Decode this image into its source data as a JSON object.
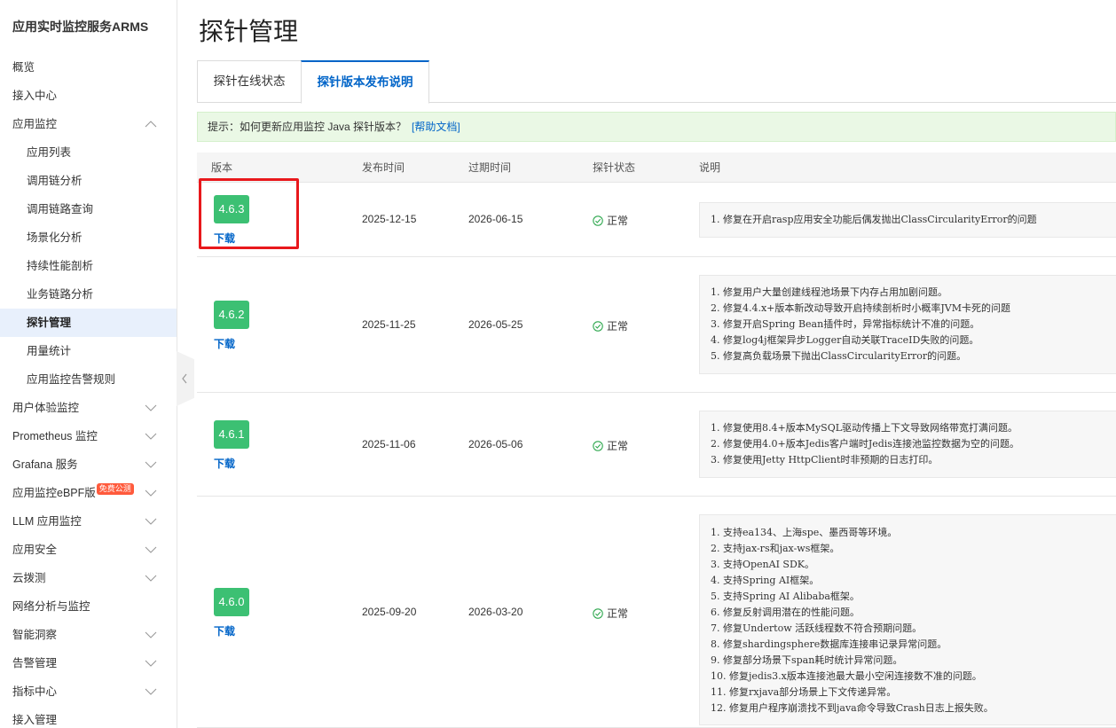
{
  "sidebar": {
    "title": "应用实时监控服务ARMS",
    "items": [
      {
        "label": "概览",
        "level": 0
      },
      {
        "label": "接入中心",
        "level": 0
      },
      {
        "label": "应用监控",
        "level": 0,
        "chevron": "up"
      },
      {
        "label": "应用列表",
        "level": 1
      },
      {
        "label": "调用链分析",
        "level": 1
      },
      {
        "label": "调用链路查询",
        "level": 1
      },
      {
        "label": "场景化分析",
        "level": 1
      },
      {
        "label": "持续性能剖析",
        "level": 1
      },
      {
        "label": "业务链路分析",
        "level": 1
      },
      {
        "label": "探针管理",
        "level": 1,
        "active": true
      },
      {
        "label": "用量统计",
        "level": 1
      },
      {
        "label": "应用监控告警规则",
        "level": 1
      },
      {
        "label": "用户体验监控",
        "level": 0,
        "chevron": "down"
      },
      {
        "label": "Prometheus 监控",
        "level": 0,
        "chevron": "down"
      },
      {
        "label": "Grafana 服务",
        "level": 0,
        "chevron": "down"
      },
      {
        "label": "应用监控eBPF版",
        "level": 0,
        "chevron": "down",
        "badge": "免费公测"
      },
      {
        "label": "LLM 应用监控",
        "level": 0,
        "chevron": "down"
      },
      {
        "label": "应用安全",
        "level": 0,
        "chevron": "down"
      },
      {
        "label": "云拨测",
        "level": 0,
        "chevron": "down"
      },
      {
        "label": "网络分析与监控",
        "level": 0
      },
      {
        "label": "智能洞察",
        "level": 0,
        "chevron": "down"
      },
      {
        "label": "告警管理",
        "level": 0,
        "chevron": "down"
      },
      {
        "label": "指标中心",
        "level": 0,
        "chevron": "down"
      },
      {
        "label": "接入管理",
        "level": 0
      }
    ]
  },
  "page": {
    "title": "探针管理"
  },
  "tabs": [
    {
      "label": "探针在线状态"
    },
    {
      "label": "探针版本发布说明",
      "active": true
    }
  ],
  "tip": {
    "text": "提示：如何更新应用监控 Java 探针版本？",
    "link": "[帮助文档]"
  },
  "table": {
    "headers": {
      "version": "版本",
      "release": "发布时间",
      "expire": "过期时间",
      "status": "探针状态",
      "notes": "说明"
    },
    "download_label": "下载",
    "rows": [
      {
        "version": "4.6.3",
        "release": "2025-12-15",
        "expire": "2026-06-15",
        "status": "正常",
        "notes": [
          "1. 修复在开启rasp应用安全功能后偶发抛出ClassCircularityError的问题"
        ]
      },
      {
        "version": "4.6.2",
        "release": "2025-11-25",
        "expire": "2026-05-25",
        "status": "正常",
        "notes": [
          "1. 修复用户大量创建线程池场景下内存占用加剧问题。",
          "2. 修复4.4.x+版本新改动导致开启持续剖析时小概率JVM卡死的问题",
          "3. 修复开启Spring Bean插件时，异常指标统计不准的问题。",
          "4. 修复log4j框架异步Logger自动关联TraceID失败的问题。",
          "5. 修复高负载场景下抛出ClassCircularityError的问题。"
        ]
      },
      {
        "version": "4.6.1",
        "release": "2025-11-06",
        "expire": "2026-05-06",
        "status": "正常",
        "notes": [
          "1. 修复使用8.4+版本MySQL驱动传播上下文导致网络带宽打满问题。",
          "2. 修复使用4.0+版本Jedis客户端时Jedis连接池监控数据为空的问题。",
          "3. 修复使用Jetty HttpClient时非预期的日志打印。"
        ]
      },
      {
        "version": "4.6.0",
        "release": "2025-09-20",
        "expire": "2026-03-20",
        "status": "正常",
        "notes": [
          "1. 支持ea134、上海spe、墨西哥等环境。",
          "2. 支持jax-rs和jax-ws框架。",
          "3. 支持OpenAI SDK。",
          "4. 支持Spring AI框架。",
          "5. 支持Spring AI Alibaba框架。",
          "6. 修复反射调用潜在的性能问题。",
          "7. 修复Undertow 活跃线程数不符合预期问题。",
          "8. 修复shardingsphere数据库连接串记录异常问题。",
          "9. 修复部分场景下span耗时统计异常问题。",
          "10. 修复jedis3.x版本连接池最大最小空闲连接数不准的问题。",
          "11. 修复rxjava部分场景上下文传递异常。",
          "12. 修复用户程序崩溃找不到java命令导致Crash日志上报失败。"
        ]
      }
    ]
  },
  "colors": {
    "accent": "#0064c8",
    "version_badge": "#3cc073",
    "highlight_border": "#e8181c",
    "tip_bg": "#eaf8e5"
  }
}
